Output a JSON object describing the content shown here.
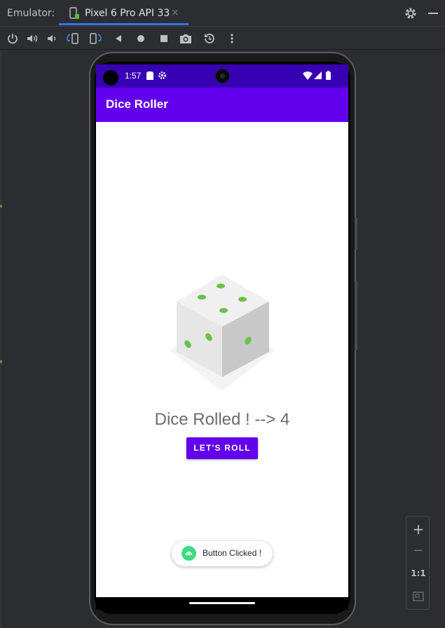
{
  "window": {
    "title": "Emulator:",
    "tab_label": "Pixel 6 Pro API 33",
    "tab_close": "×"
  },
  "toolbar_icons": [
    "power-icon",
    "volume-up-icon",
    "volume-down-icon",
    "rotate-left-icon",
    "rotate-right-icon",
    "back-icon",
    "home-icon",
    "overview-icon",
    "screenshot-icon",
    "snapshot-icon",
    "more-icon"
  ],
  "device": {
    "status_time": "1:57",
    "app_title": "Dice Roller",
    "result_text": "Dice Rolled ! --> 4",
    "roll_button": "LET'S ROLL",
    "toast_text": "Button Clicked !"
  },
  "zoom": {
    "plus": "+",
    "minus": "−",
    "one_to_one": "1:1"
  },
  "colors": {
    "status_bar": "#3700b3",
    "app_bar": "#6200ee",
    "button": "#6200ee",
    "accent_tab": "#3574f0",
    "dice_pips": "#6cc04a"
  }
}
